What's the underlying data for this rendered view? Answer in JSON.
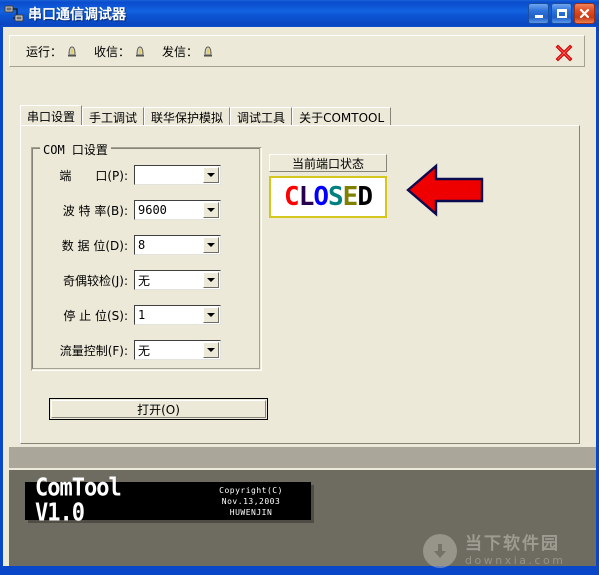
{
  "window": {
    "title": "串口通信调试器",
    "icon": "serial-port-icon",
    "controls": {
      "minimize": "最小化",
      "maximize": "最大化",
      "close": "关闭"
    },
    "colors": {
      "titlebar": "#0a4ccd",
      "client_bg": "#ece9d8",
      "band_light": "#aaa79a",
      "band_dark": "#6e6b61",
      "status_border": "#d4c81e"
    }
  },
  "toolbar": {
    "items": [
      {
        "label": "运行：",
        "icon": "lamp-icon",
        "state": "off"
      },
      {
        "label": "收信：",
        "icon": "lamp-icon",
        "state": "off"
      },
      {
        "label": "发信：",
        "icon": "lamp-icon",
        "state": "off"
      }
    ],
    "exit": {
      "icon": "red-x-icon",
      "label": "退出"
    }
  },
  "tabs": [
    {
      "label": "串口设置",
      "active": true
    },
    {
      "label": "手工调试",
      "active": false
    },
    {
      "label": "联华保护模拟",
      "active": false
    },
    {
      "label": "调试工具",
      "active": false
    },
    {
      "label": "关于COMTOOL",
      "active": false
    }
  ],
  "com_settings": {
    "group_title": "COM 口设置",
    "fields": [
      {
        "label": "端　　口(P):",
        "value": ""
      },
      {
        "label": "波 特 率(B):",
        "value": "9600"
      },
      {
        "label": "数 据 位(D):",
        "value": "8"
      },
      {
        "label": "奇偶较检(J):",
        "value": "无"
      },
      {
        "label": "停 止 位(S):",
        "value": "1"
      },
      {
        "label": "流量控制(F):",
        "value": "无"
      }
    ],
    "open_button": "打开(O)"
  },
  "port_status": {
    "header": "当前端口状态",
    "value": "CLOSED",
    "letters": [
      {
        "ch": "C",
        "color": "#ff0000"
      },
      {
        "ch": "L",
        "color": "#28004e"
      },
      {
        "ch": "O",
        "color": "#0000ff"
      },
      {
        "ch": "S",
        "color": "#008080"
      },
      {
        "ch": "E",
        "color": "#808000"
      },
      {
        "ch": "D",
        "color": "#000000"
      }
    ]
  },
  "annotation": {
    "arrow": "red-left-arrow",
    "fill": "#ee0000",
    "outline": "#0b0b50"
  },
  "banner": {
    "logo": "ComTool V1.0",
    "copyright": "Copyright(C) Nov.13,2003",
    "author": "HUWENJIN"
  },
  "watermark": {
    "icon": "download-arrow-icon",
    "name": "当下软件园",
    "site": "downxia.com"
  }
}
